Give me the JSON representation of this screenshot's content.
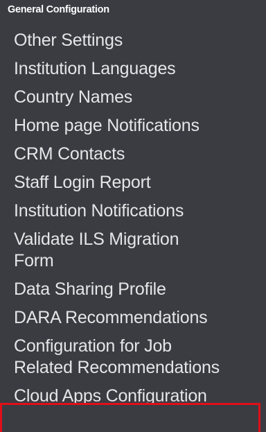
{
  "section": {
    "title": "General Configuration"
  },
  "menu": {
    "items": [
      {
        "label": "Other Settings"
      },
      {
        "label": "Institution Languages"
      },
      {
        "label": "Country Names"
      },
      {
        "label": "Home page Notifications"
      },
      {
        "label": "CRM Contacts"
      },
      {
        "label": "Staff Login Report"
      },
      {
        "label": "Institution Notifications"
      },
      {
        "label_line1": "Validate ILS Migration",
        "label_line2": "Form"
      },
      {
        "label": "Data Sharing Profile"
      },
      {
        "label": "DARA Recommendations"
      },
      {
        "label_line1": "Configuration for Job",
        "label_line2": "Related Recommendations"
      },
      {
        "label": "Cloud Apps Configuration"
      }
    ]
  },
  "colors": {
    "background": "#3a3c42",
    "text": "#e6e6e8",
    "highlight": "#e0101a"
  }
}
